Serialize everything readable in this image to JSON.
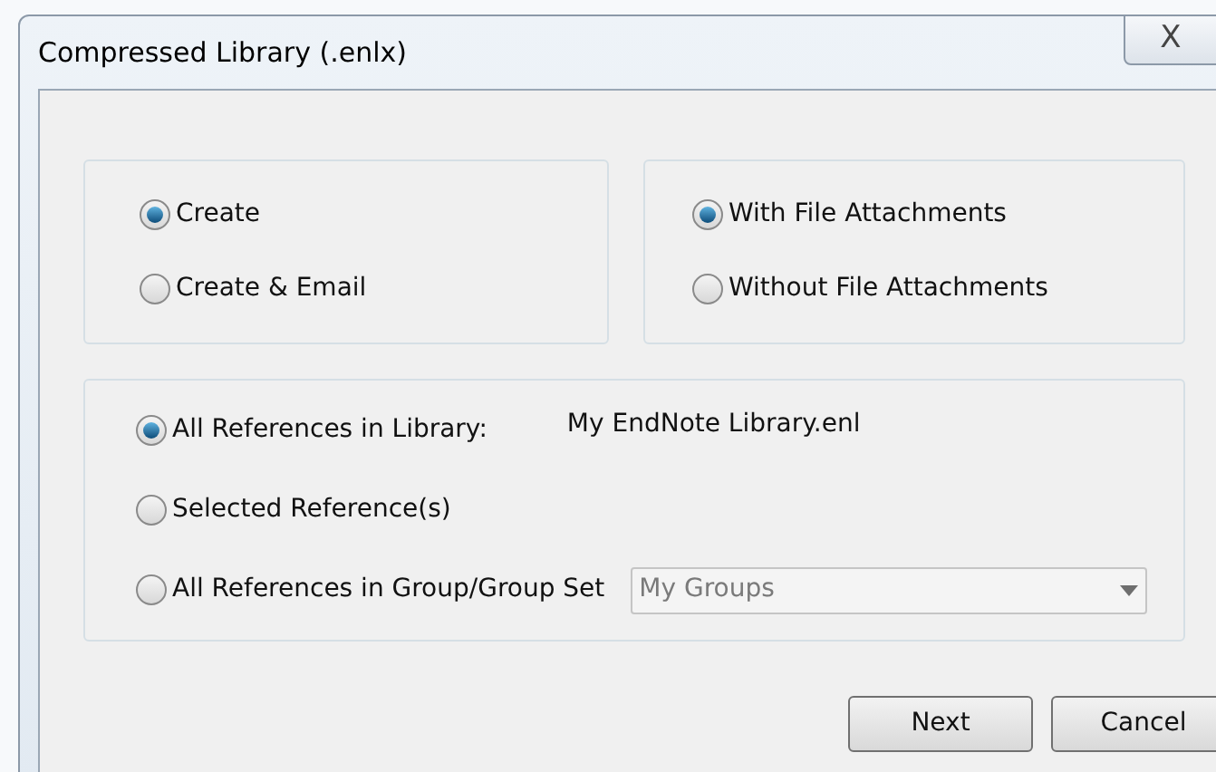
{
  "window": {
    "title": "Compressed Library (.enlx)",
    "close": "X"
  },
  "action_options": [
    {
      "label": "Create",
      "selected": true
    },
    {
      "label": "Create & Email",
      "selected": false
    }
  ],
  "attachment_options": [
    {
      "label": "With File Attachments",
      "selected": true
    },
    {
      "label": "Without File Attachments",
      "selected": false
    }
  ],
  "reference_options": [
    {
      "label": "All References in Library:",
      "selected": true,
      "kind": "library",
      "value": "My EndNote Library.enl"
    },
    {
      "label": "Selected Reference(s)",
      "selected": false,
      "kind": "plain"
    },
    {
      "label": "All References in Group/Group Set",
      "selected": false,
      "kind": "group",
      "dropdown": {
        "value": "My Groups",
        "disabled": true
      }
    }
  ],
  "buttons": [
    "Next",
    "Cancel"
  ]
}
